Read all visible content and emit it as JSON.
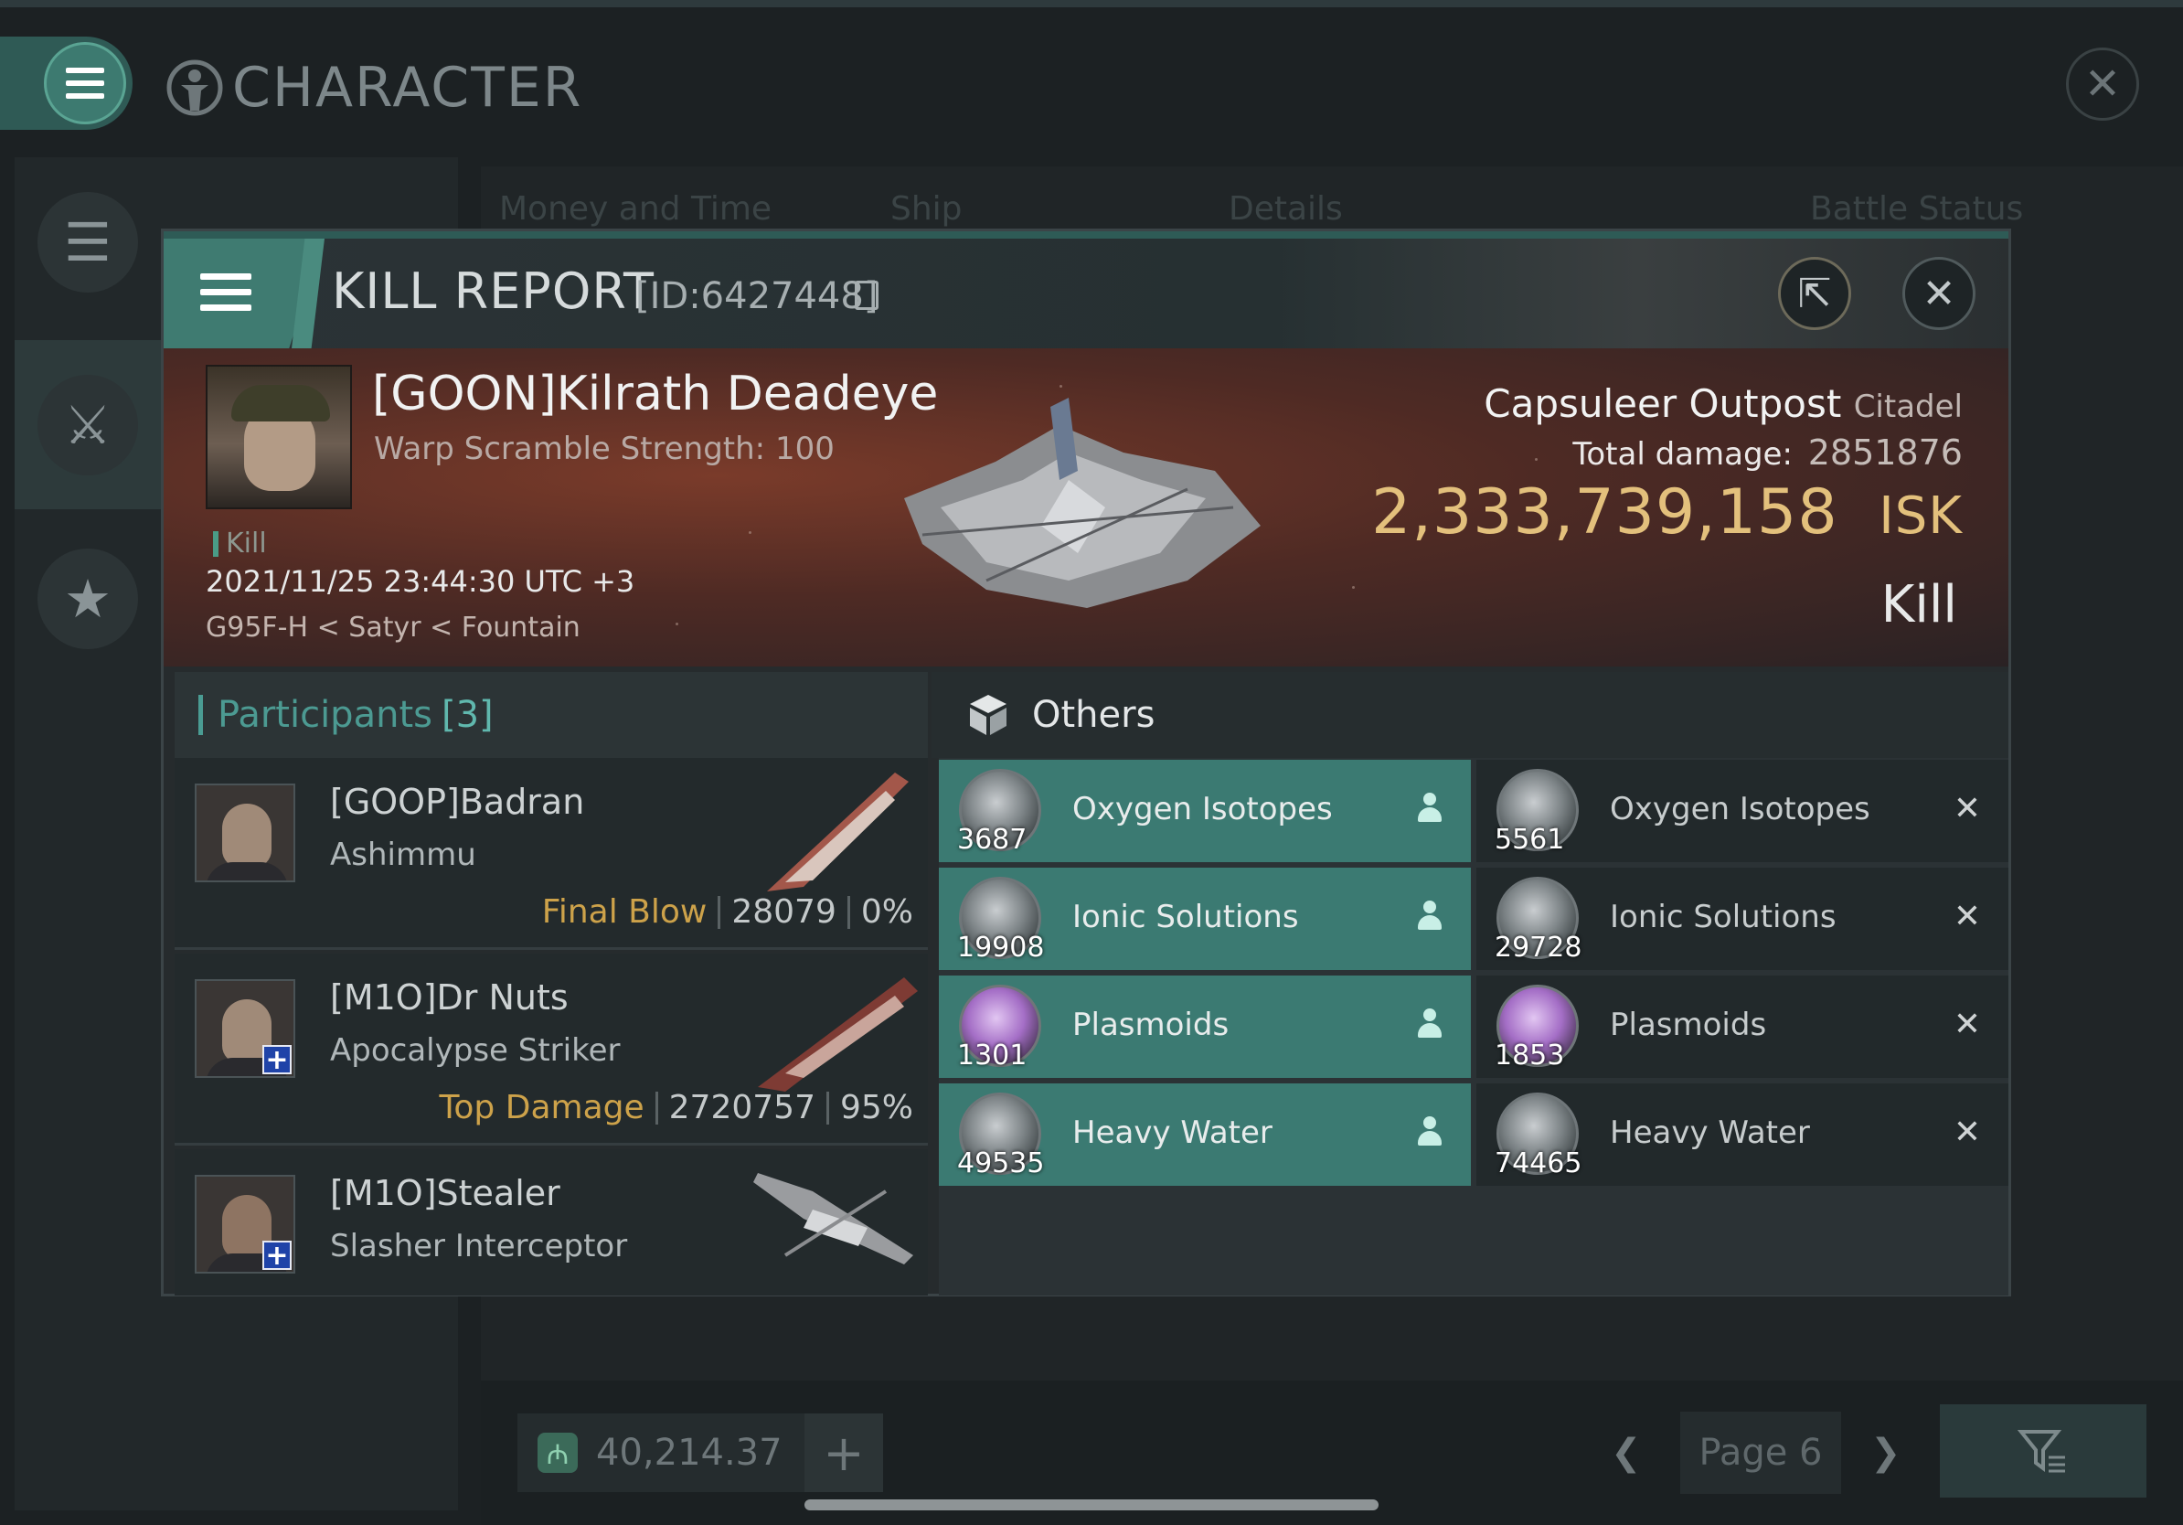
{
  "app": {
    "title": "CHARACTER",
    "close_icon": "close-icon"
  },
  "background": {
    "tabs": [
      "Money and Time",
      "Ship",
      "Details",
      "Battle Status"
    ],
    "wallet_value": "40,214.37",
    "page_label": "Page 6"
  },
  "kill_report": {
    "title": "KILL REPORT",
    "id_label": "[ID:6427448]",
    "victim": {
      "name": "[GOON]Kilrath Deadeye",
      "subtitle": "Warp Scramble Strength: 100",
      "tag": "Kill",
      "datetime": "2021/11/25 23:44:30 UTC +3",
      "location": "G95F-H < Satyr < Fountain",
      "structure": "Capsuleer Outpost",
      "structure_class": "Citadel",
      "total_damage_label": "Total damage:",
      "total_damage": "2851876",
      "isk_value": "2,333,739,158",
      "isk_currency": "ISK",
      "result": "Kill"
    },
    "participants": {
      "label": "Participants",
      "count": "[3]",
      "list": [
        {
          "name": "[GOOP]Badran",
          "ship": "Ashimmu",
          "tag": "Final Blow",
          "damage": "28079",
          "percent": "0%"
        },
        {
          "name": "[M1O]Dr Nuts",
          "ship": "Apocalypse Striker",
          "tag": "Top Damage",
          "damage": "2720757",
          "percent": "95%"
        },
        {
          "name": "[M1O]Stealer",
          "ship": "Slasher Interceptor"
        }
      ]
    },
    "others": {
      "label": "Others",
      "dropped": [
        {
          "name": "Oxygen Isotopes",
          "qty": "3687"
        },
        {
          "name": "Ionic Solutions",
          "qty": "19908"
        },
        {
          "name": "Plasmoids",
          "qty": "1301"
        },
        {
          "name": "Heavy Water",
          "qty": "49535"
        }
      ],
      "destroyed": [
        {
          "name": "Oxygen Isotopes",
          "qty": "5561"
        },
        {
          "name": "Ionic Solutions",
          "qty": "29728"
        },
        {
          "name": "Plasmoids",
          "qty": "1853"
        },
        {
          "name": "Heavy Water",
          "qty": "74465"
        }
      ]
    }
  },
  "colors": {
    "accent": "#3b7a72",
    "isk": "#e3c07c",
    "tag": "#cda24a"
  }
}
